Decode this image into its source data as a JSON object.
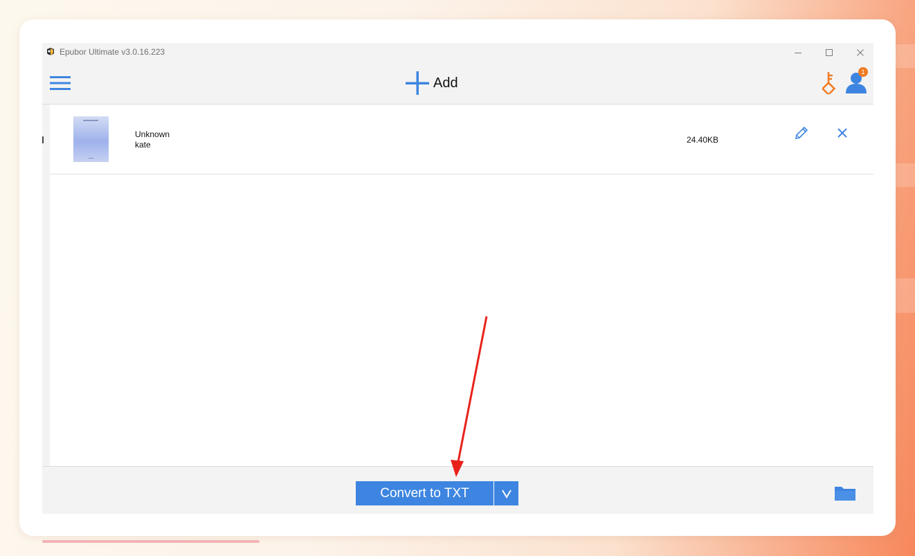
{
  "window": {
    "title": "Epubor Ultimate v3.0.16.223",
    "controls": [
      "minimize-icon",
      "maximize-icon",
      "close-icon"
    ]
  },
  "toolbar": {
    "menu_icon": "hamburger-menu-icon",
    "add_label": "Add",
    "add_icon": "plus-icon",
    "key_icon": "key-icon",
    "user_icon": "user-icon",
    "notification_count": "1"
  },
  "books": [
    {
      "title": "Unknown",
      "author": "kate",
      "size": "24.40KB",
      "edit_icon": "pencil-icon",
      "remove_icon": "close-icon"
    }
  ],
  "bottom": {
    "convert_label": "Convert to TXT",
    "dropdown_icon": "chevron-down-icon",
    "folder_icon": "folder-icon"
  },
  "colors": {
    "accent_blue": "#3d85e0",
    "key_orange": "#f07a22",
    "annotation_red": "#e8221b"
  }
}
